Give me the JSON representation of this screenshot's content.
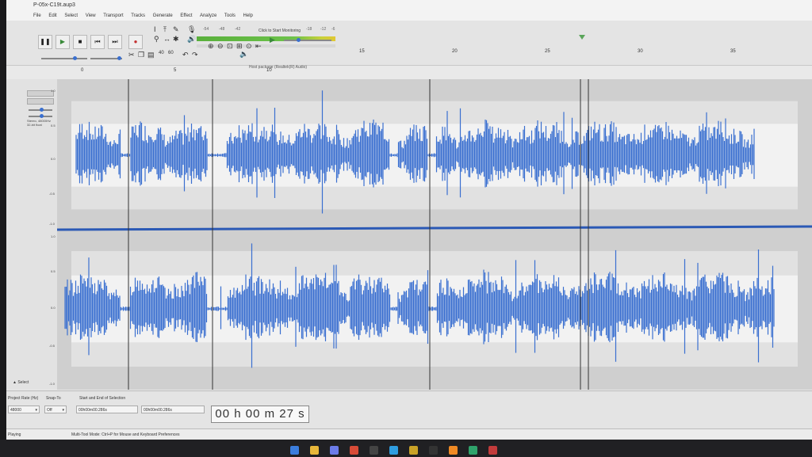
{
  "window": {
    "title": "P-05x-C19t.aup3"
  },
  "menu": [
    "File",
    "Edit",
    "Select",
    "View",
    "Transport",
    "Tracks",
    "Generate",
    "Effect",
    "Analyze",
    "Tools",
    "Help"
  ],
  "toolbar": {
    "monitor_label": "Click to Start Monitoring",
    "meter_ticks": [
      "-54",
      "-48",
      "-42",
      "-36",
      "-30",
      "-24",
      "-18",
      "-12",
      "-6",
      "0"
    ],
    "host_label": "Host package (Realtek(R) Audio)",
    "zoom_values": [
      "40",
      "60"
    ]
  },
  "ruler": {
    "labels": [
      {
        "t": "0",
        "major": false
      },
      {
        "t": "5",
        "major": false
      },
      {
        "t": "10",
        "major": false
      },
      {
        "t": "15",
        "major": true
      },
      {
        "t": "20",
        "major": true
      },
      {
        "t": "25",
        "major": true
      },
      {
        "t": "30",
        "major": true
      },
      {
        "t": "35",
        "major": true
      }
    ],
    "playhead_seconds": 27
  },
  "track": {
    "info": "Stereo, 48000Hz 32-bit float",
    "amp_labels": [
      "1.0",
      "0.5",
      "0.0",
      "-0.5",
      "-1.0"
    ],
    "select_label": "Select"
  },
  "selection": {
    "project_rate_label": "Project Rate (Hz)",
    "project_rate_value": "48000",
    "snap_label": "Snap-To",
    "snap_value": "Off",
    "start_end_label": "Start and End of Selection",
    "start_value": "00h00m00.286s",
    "end_value": "00h00m00.286s",
    "time_display": "00 h 00 m 27 s"
  },
  "status": {
    "state": "Playing",
    "hint": "Multi-Tool Mode: Ctrl+P for Mouse and Keyboard Preferences"
  },
  "colors": {
    "wave": "#3a6fd0",
    "wave_dark": "#2b59b5",
    "bg_light": "#f2f2f2",
    "bg_mid": "#e1e1e1",
    "bg_dark": "#cfcfcf",
    "meter_green": "#6cc24a"
  },
  "taskbar_icons": [
    "windows-start",
    "file-explorer",
    "discord",
    "chrome",
    "obs",
    "terminal",
    "taskmgr",
    "app-a",
    "app-b",
    "app-c",
    "app-d"
  ]
}
